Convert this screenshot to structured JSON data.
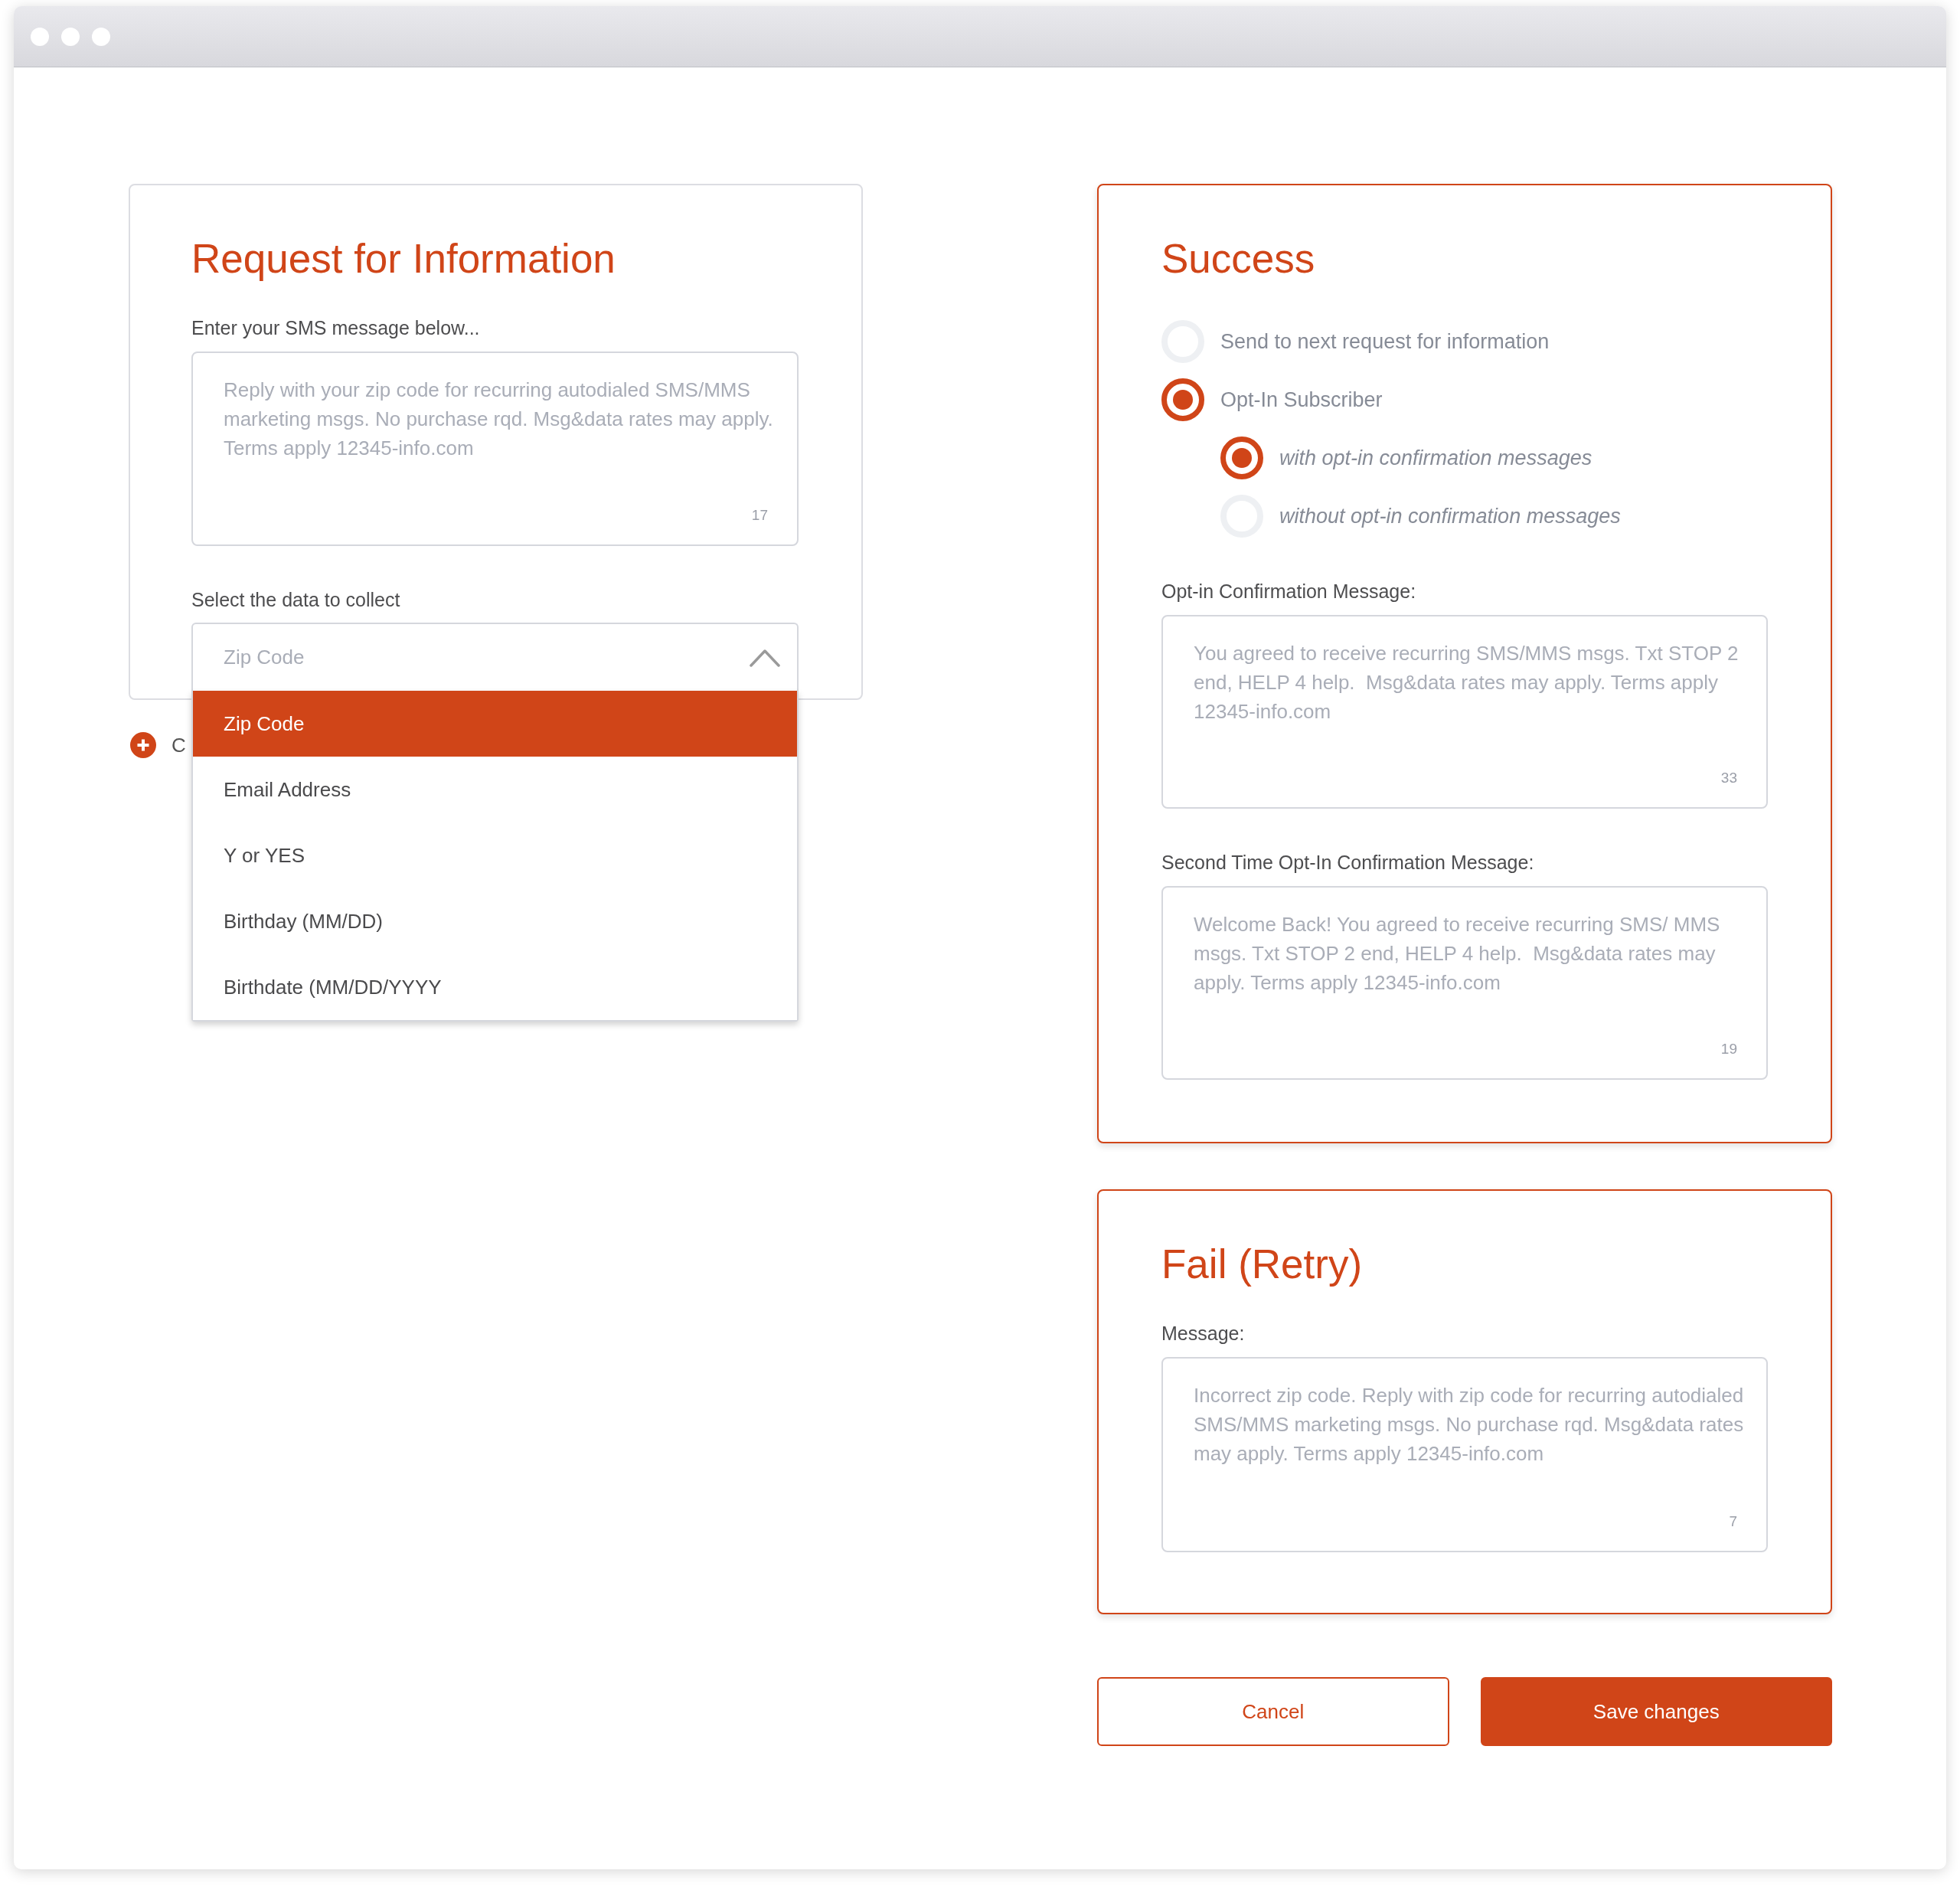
{
  "request_card": {
    "title": "Request for Information",
    "message_label": "Enter your SMS message below...",
    "message": {
      "placeholder": "Reply with your zip code for recurring autodialed SMS/MMS marketing msgs. No purchase rqd. Msg&data rates may apply. Terms apply 12345-info.com",
      "count": "17"
    },
    "select_label": "Select the data to collect",
    "select": {
      "value": "Zip Code",
      "expanded": true,
      "options": [
        {
          "label": "Zip Code",
          "selected": true
        },
        {
          "label": "Email Address",
          "selected": false
        },
        {
          "label": "Y or YES",
          "selected": false
        },
        {
          "label": "Birthday (MM/DD)",
          "selected": false
        },
        {
          "label": "Birthdate (MM/DD/YYYY",
          "selected": false
        }
      ]
    }
  },
  "add_link": {
    "label": "C"
  },
  "success_card": {
    "title": "Success",
    "options": [
      {
        "label": "Send to next request for information",
        "selected": false
      },
      {
        "label": "Opt-In Subscriber",
        "selected": true,
        "children": [
          {
            "label": "with opt-in confirmation messages",
            "selected": true
          },
          {
            "label": "without opt-in confirmation messages",
            "selected": false
          }
        ]
      }
    ],
    "fields": [
      {
        "label": "Opt-in Confirmation Message:",
        "placeholder": "You agreed to receive recurring SMS/MMS msgs. Txt STOP 2 end, HELP 4 help.  Msg&data rates may apply. Terms apply 12345-info.com",
        "count": "33"
      },
      {
        "label": "Second Time Opt-In Confirmation Message:",
        "placeholder": "Welcome Back! You agreed to receive recurring SMS/ MMS msgs. Txt STOP 2 end, HELP 4 help.  Msg&data rates may apply. Terms apply 12345-info.com",
        "count": "19"
      }
    ]
  },
  "fail_card": {
    "title": "Fail (Retry)",
    "fields": [
      {
        "label": "Message:",
        "placeholder": "Incorrect zip code. Reply with zip code for recurring autodialed SMS/MMS marketing msgs. No purchase rqd. Msg&data rates may apply. Terms apply 12345-info.com",
        "count": "7"
      }
    ]
  },
  "buttons": [
    {
      "label": "Cancel",
      "kind": "secondary"
    },
    {
      "label": "Save changes",
      "kind": "primary"
    }
  ]
}
